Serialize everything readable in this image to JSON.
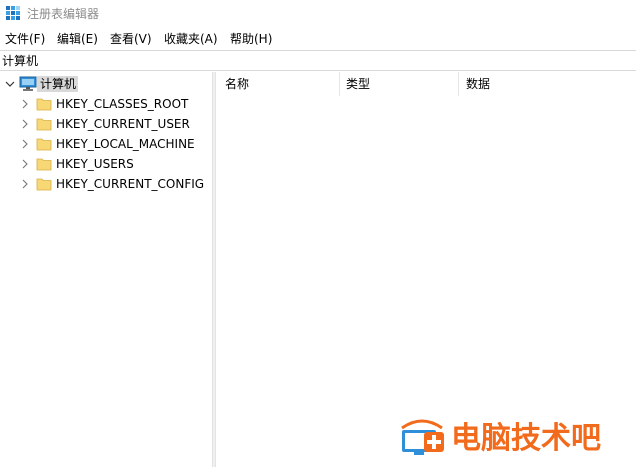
{
  "window": {
    "title": "注册表编辑器"
  },
  "menu": [
    {
      "label": "文件(F)"
    },
    {
      "label": "编辑(E)"
    },
    {
      "label": "查看(V)"
    },
    {
      "label": "收藏夹(A)"
    },
    {
      "label": "帮助(H)"
    }
  ],
  "address": {
    "path": "计算机"
  },
  "tree": {
    "root": {
      "label": "计算机",
      "icon": "computer-icon",
      "expanded": true
    },
    "keys": [
      {
        "label": "HKEY_CLASSES_ROOT",
        "icon": "folder-icon"
      },
      {
        "label": "HKEY_CURRENT_USER",
        "icon": "folder-icon"
      },
      {
        "label": "HKEY_LOCAL_MACHINE",
        "icon": "folder-icon"
      },
      {
        "label": "HKEY_USERS",
        "icon": "folder-icon"
      },
      {
        "label": "HKEY_CURRENT_CONFIG",
        "icon": "folder-icon"
      }
    ]
  },
  "list": {
    "columns": [
      {
        "label": "名称"
      },
      {
        "label": "类型"
      },
      {
        "label": "数据"
      }
    ]
  },
  "watermark": {
    "text": "电脑技术吧"
  },
  "colors": {
    "watermark": "#f26a1b",
    "folder": "#f8d775",
    "highlight": "#d9d9d9"
  }
}
